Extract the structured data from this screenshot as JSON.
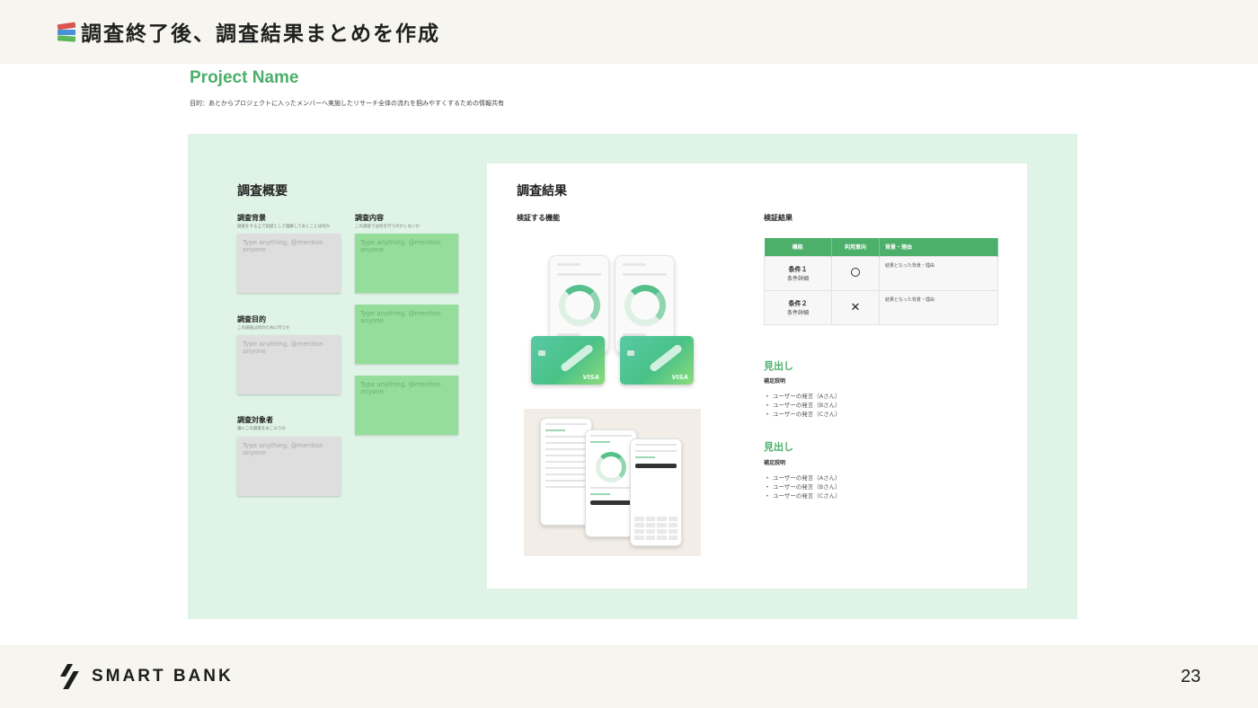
{
  "header": {
    "title": "調査終了後、調査結果まとめを作成",
    "icon": "books-icon"
  },
  "doc": {
    "project_name": "Project Name",
    "purpose": "目的：あとからプロジェクトに入ったメンバーへ実施したリサーチ全体の流れを掴みやすくするための情報共有"
  },
  "overview": {
    "title": "調査概要",
    "background": {
      "label": "調査背景",
      "sub": "調査をする上で前提として理解しておくことは何か"
    },
    "goal": {
      "label": "調査目的",
      "sub": "この調査は何のために行うか"
    },
    "target": {
      "label": "調査対象者",
      "sub": "誰にこの調査をおこなうか"
    },
    "content": {
      "label": "調査内容",
      "sub": "この調査では何を行うのかしないか"
    },
    "placeholder": "Type anything, @mention anyone"
  },
  "results": {
    "title": "調査結果",
    "feature_label": "検証する機能",
    "verify_label": "検証結果",
    "table": {
      "headers": [
        "機能",
        "利用意向",
        "背景・理由"
      ],
      "rows": [
        {
          "name": "条件１",
          "detail": "条件詳細",
          "mark": "○",
          "reason": "結果となった背景・理由"
        },
        {
          "name": "条件２",
          "detail": "条件詳細",
          "mark": "✕",
          "reason": "結果となった背景・理由"
        }
      ]
    },
    "sections": [
      {
        "heading": "見出し",
        "note": "補足説明",
        "bullets": [
          "ユーザーの発言（Aさん）",
          "ユーザーの発言（Bさん）",
          "ユーザーの発言（Cさん）"
        ]
      },
      {
        "heading": "見出し",
        "note": "補足説明",
        "bullets": [
          "ユーザーの発言（Aさん）",
          "ユーザーの発言（Bさん）",
          "ユーザーの発言（Cさん）"
        ]
      }
    ],
    "card_brand": "VISA"
  },
  "footer": {
    "logo_text": "SMART BANK",
    "page_number": "23"
  },
  "colors": {
    "accent_green": "#4caf6a",
    "board_bg": "#dff3e6",
    "sticky_green": "#95dd9b",
    "sticky_gray": "#dedede",
    "header_bg": "#f6f5f0"
  }
}
